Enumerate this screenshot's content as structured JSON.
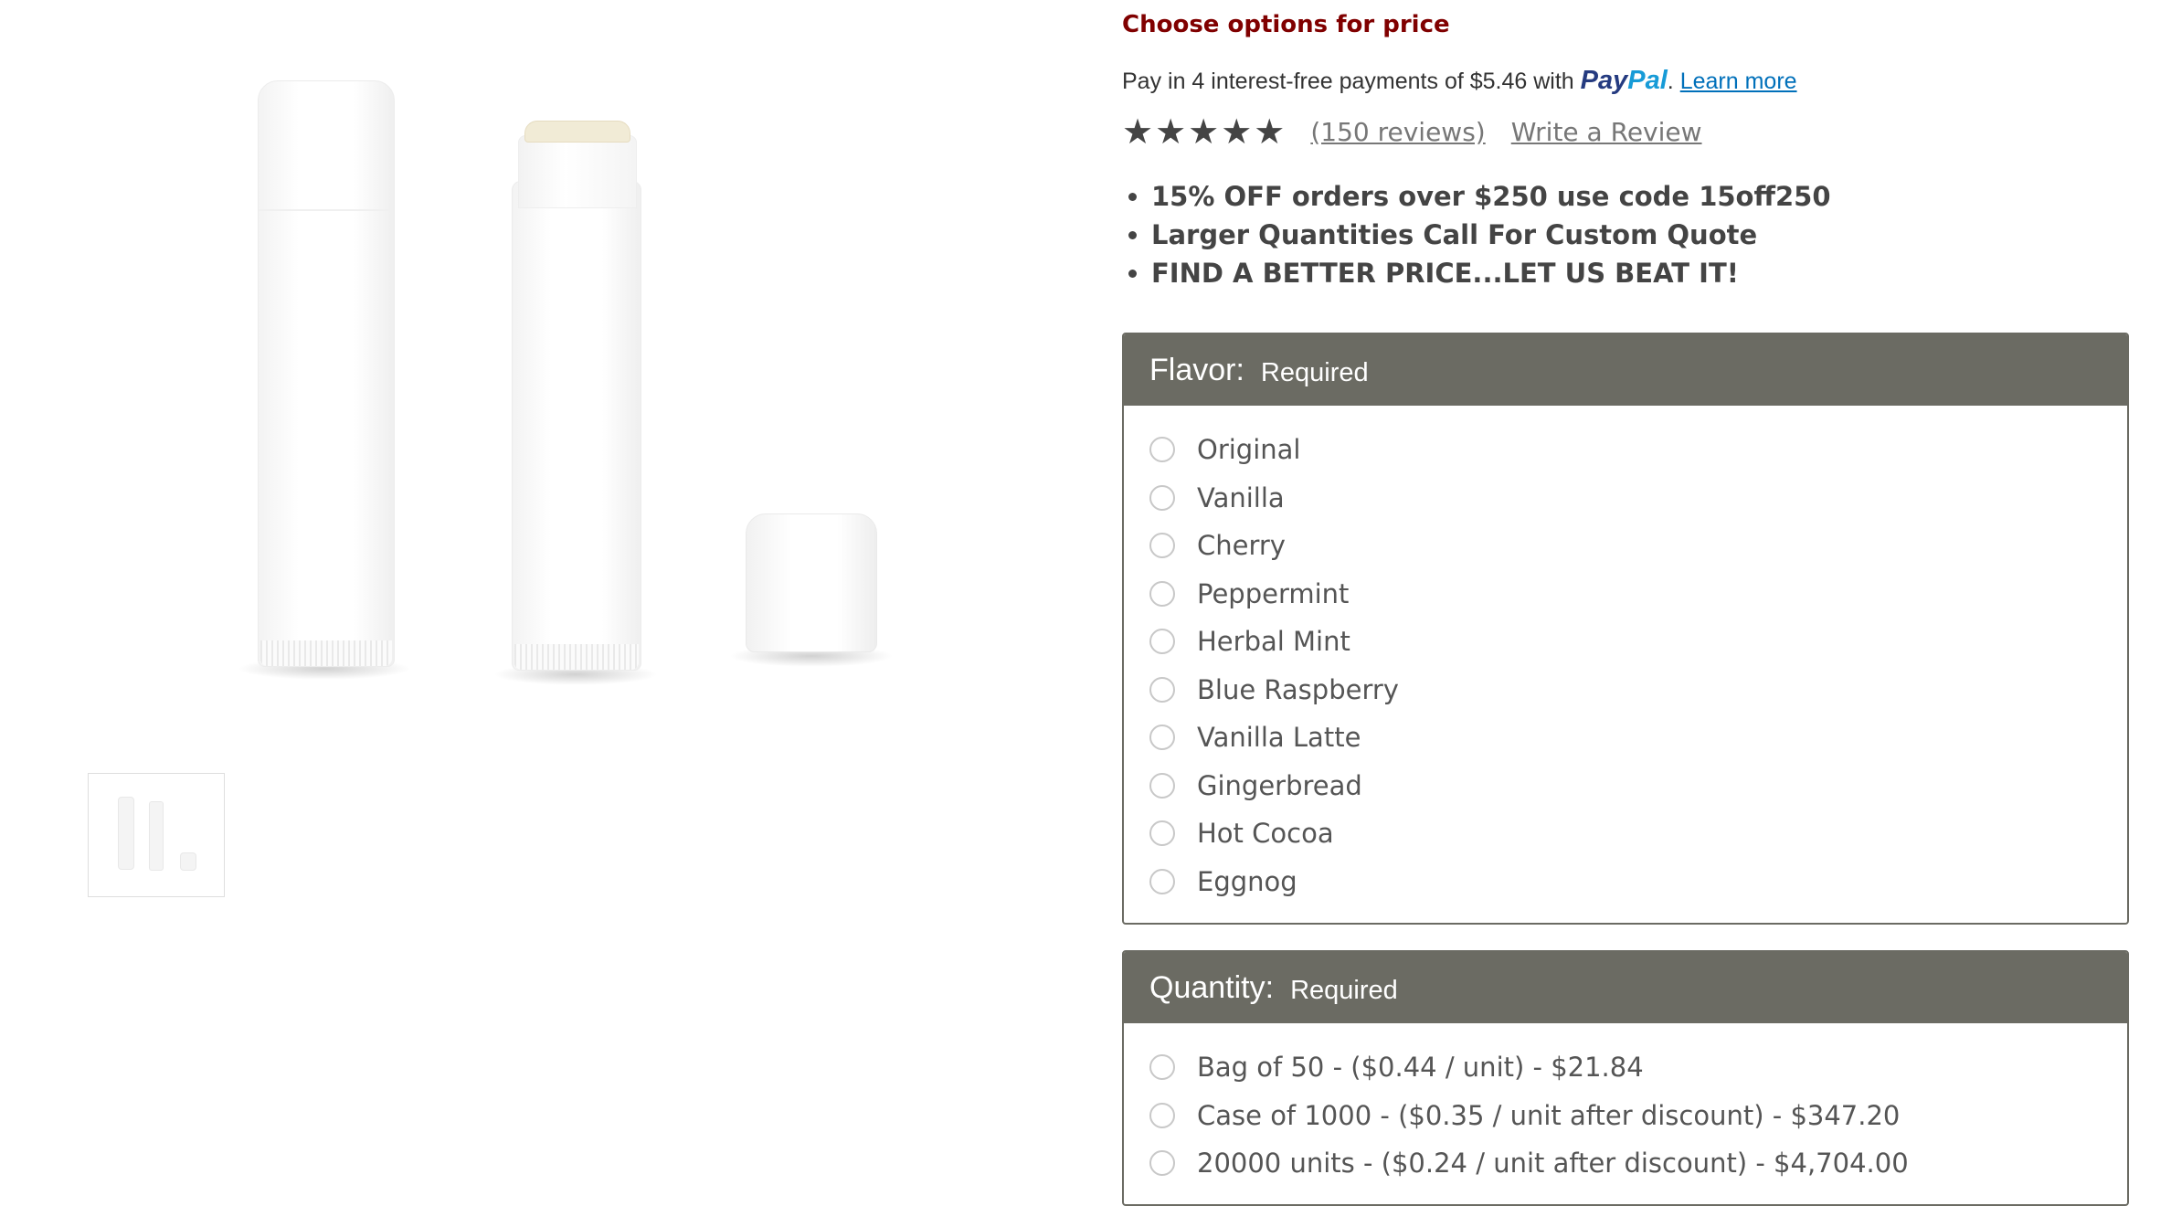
{
  "gallery": {
    "main_image_alt": "White lip balm tubes with cap",
    "thumbnail_alt": "Lip balm tubes thumbnail"
  },
  "product": {
    "price_note": "Choose options for price",
    "paypal": {
      "text": "Pay in 4 interest-free payments of $5.46 with",
      "logo_pay": "Pay",
      "logo_pal": "Pal",
      "suffix": ".",
      "learn_more": "Learn more"
    },
    "rating": {
      "stars": 5,
      "stars_display": "★★★★★",
      "reviews": "(150 reviews)",
      "write_review": "Write a Review"
    },
    "promos": [
      "15% OFF orders over $250 use code 15off250",
      "Larger Quantities Call For Custom Quote",
      "FIND A BETTER PRICE...LET US BEAT IT!"
    ]
  },
  "flavor": {
    "title": "Flavor:",
    "required": "Required",
    "options": [
      "Original",
      "Vanilla",
      "Cherry",
      "Peppermint",
      "Herbal Mint",
      "Blue Raspberry",
      "Vanilla Latte",
      "Gingerbread",
      "Hot Cocoa",
      "Eggnog"
    ]
  },
  "quantity": {
    "title": "Quantity:",
    "required": "Required",
    "options": [
      "Bag of 50 - ($0.44 / unit) - $21.84",
      "Case of 1000 - ($0.35 / unit after discount) - $347.20",
      "20000 units - ($0.24 / unit after discount) - $4,704.00"
    ]
  },
  "colors": {
    "price_note": "#800000",
    "option_header": "#6b6b63",
    "paypal_blue": "#253b80",
    "paypal_light": "#179bd7",
    "link": "#0070ba"
  }
}
